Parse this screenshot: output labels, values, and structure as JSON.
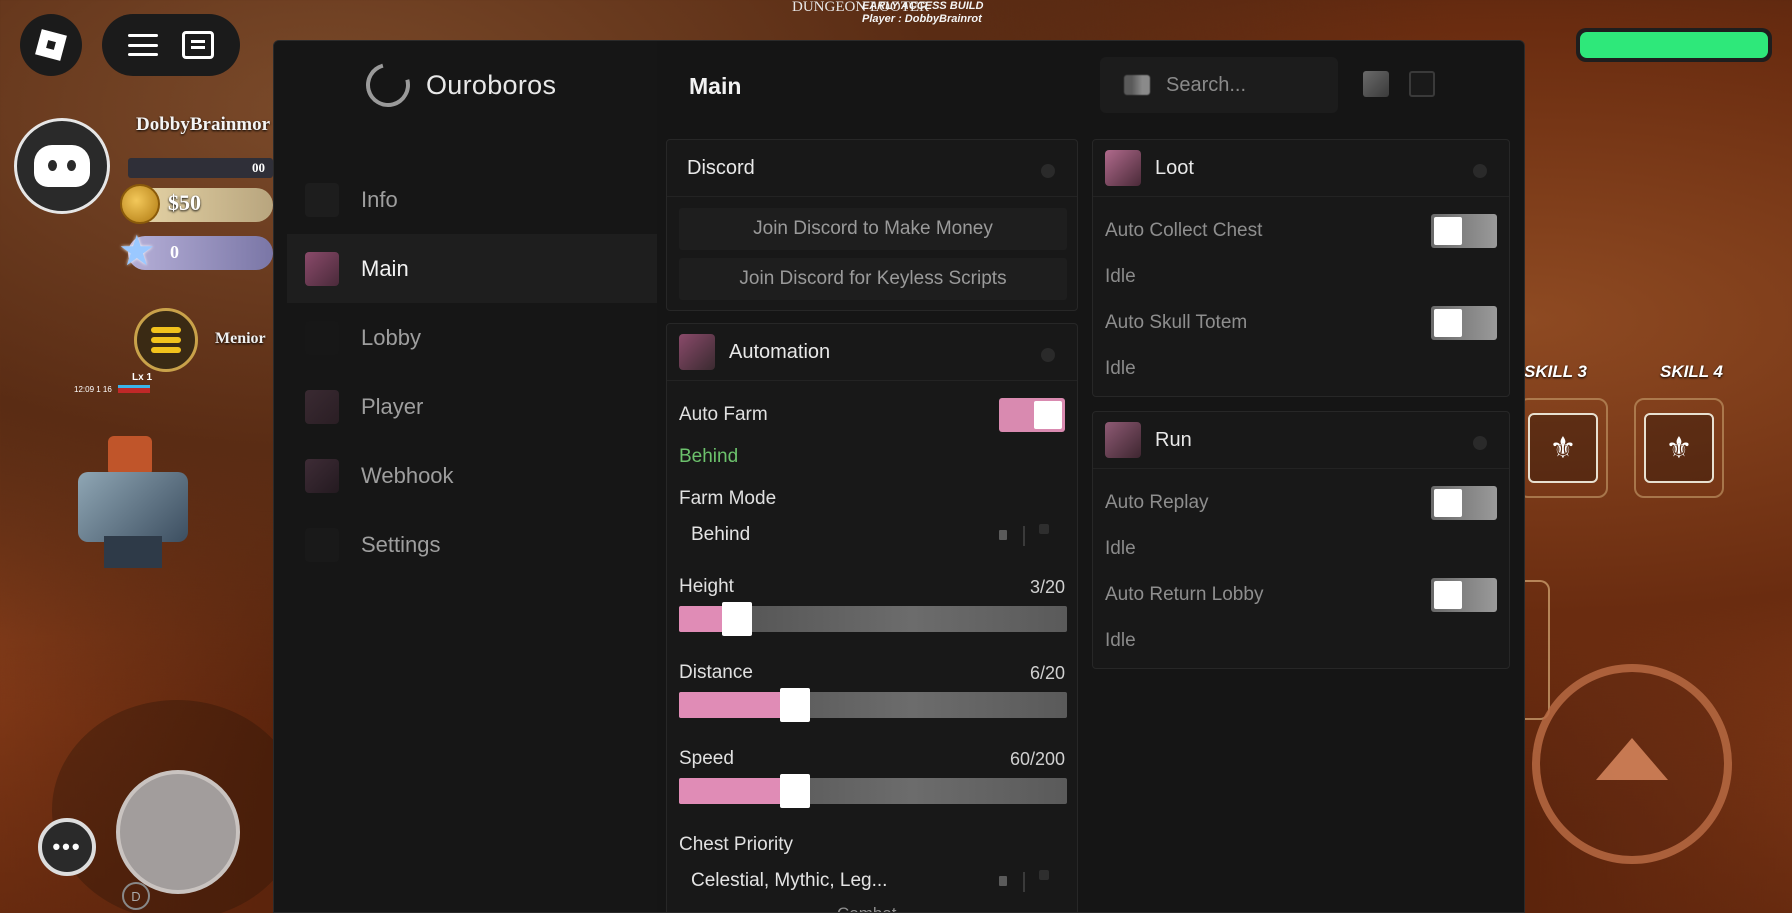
{
  "game": {
    "top_logo": "DUNGEON LOOTER",
    "build_line1": "EARLY ACCESS BUILD",
    "build_line2": "Player : DobbyBrainrot",
    "player_name": "DobbyBrainmor",
    "xp_value": "00",
    "coins": "$50",
    "gems": "0",
    "quest_name": "Menior",
    "mini_level": "Lx 1",
    "mini_time": "12:09 1 16",
    "skill3_label": "SKILL 3",
    "skill4_label": "SKILL 4",
    "more_label": "•••",
    "d_label": "D",
    "health_color": "#2ee87a",
    "accent_pink": "#e08cb6"
  },
  "window": {
    "brand_name": "Ouroboros",
    "header_title": "Main",
    "search_placeholder": "Search..."
  },
  "sidebar": {
    "items": [
      {
        "label": "Info",
        "active": false,
        "icon": "info-icon"
      },
      {
        "label": "Main",
        "active": true,
        "icon": "main-icon"
      },
      {
        "label": "Lobby",
        "active": false,
        "icon": "lobby-icon"
      },
      {
        "label": "Player",
        "active": false,
        "icon": "player-icon"
      },
      {
        "label": "Webhook",
        "active": false,
        "icon": "webhook-icon"
      },
      {
        "label": "Settings",
        "active": false,
        "icon": "settings-icon"
      }
    ]
  },
  "discord_panel": {
    "title": "Discord",
    "button1": "Join Discord to Make Money",
    "button2": "Join Discord for Keyless Scripts"
  },
  "automation_panel": {
    "title": "Automation",
    "auto_farm_label": "Auto Farm",
    "auto_farm_on": true,
    "auto_farm_status": "Behind",
    "farm_mode_label": "Farm Mode",
    "farm_mode_value": "Behind",
    "height_label": "Height",
    "height_value": "3/20",
    "height_fraction": 0.15,
    "distance_label": "Distance",
    "distance_value": "6/20",
    "distance_fraction": 0.3,
    "speed_label": "Speed",
    "speed_value": "60/200",
    "speed_fraction": 0.3,
    "chest_priority_label": "Chest Priority",
    "chest_priority_value": "Celestial, Mythic, Leg...",
    "next_section": "Combat"
  },
  "loot_panel": {
    "title": "Loot",
    "auto_collect_label": "Auto Collect Chest",
    "auto_collect_on": false,
    "auto_collect_status": "Idle",
    "auto_skull_label": "Auto Skull Totem",
    "auto_skull_on": false,
    "auto_skull_status": "Idle"
  },
  "run_panel": {
    "title": "Run",
    "auto_replay_label": "Auto Replay",
    "auto_replay_on": false,
    "auto_replay_status": "Idle",
    "auto_return_label": "Auto Return Lobby",
    "auto_return_on": false,
    "auto_return_status": "Idle"
  }
}
